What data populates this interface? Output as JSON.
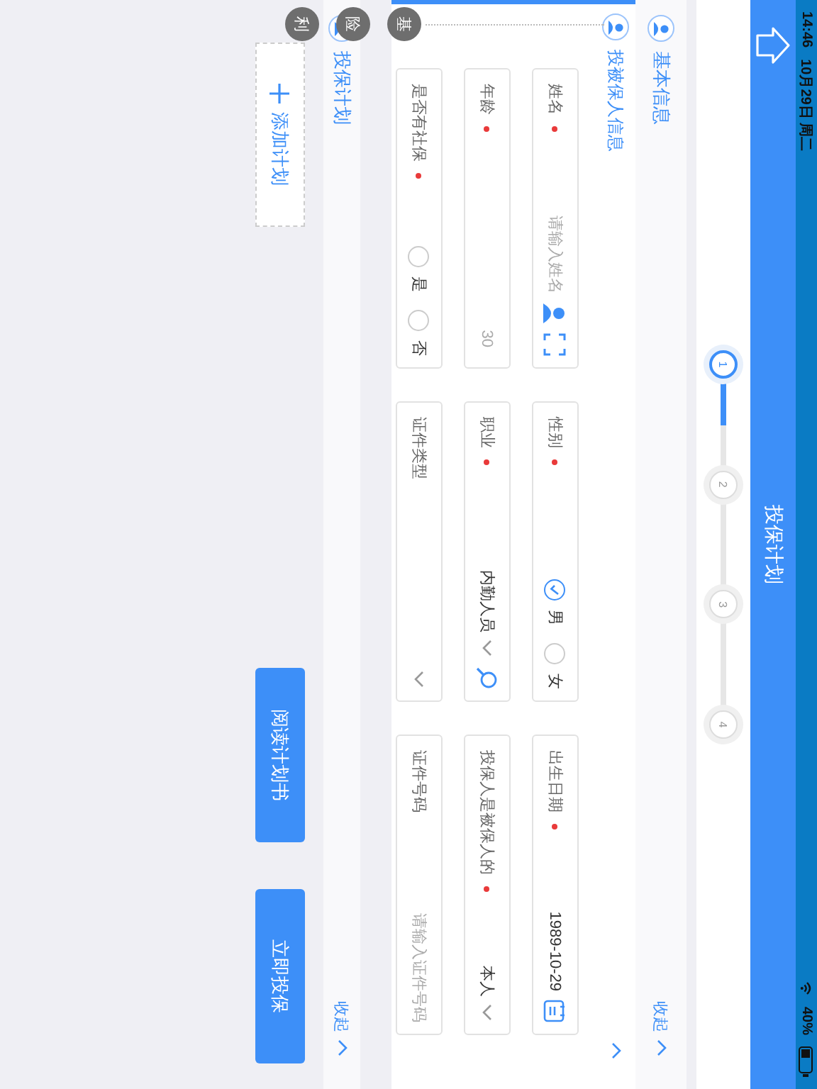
{
  "status_bar": {
    "time": "14:46",
    "date": "10月29日 周二",
    "battery": "40%"
  },
  "header": {
    "title": "投保计划"
  },
  "stepper": {
    "level": 0.17,
    "steps": [
      {
        "label": "1",
        "selected": true
      },
      {
        "label": "2",
        "selected": false
      },
      {
        "label": "3",
        "selected": false
      },
      {
        "label": "4",
        "selected": false
      }
    ]
  },
  "basic_info": {
    "title": "基本信息",
    "toggle": "收起",
    "subsection": {
      "title": "投被保人信息",
      "expanded": true
    },
    "fields": [
      {
        "label": "姓名",
        "required": true,
        "kind": "name",
        "placeholder": "请输入姓名"
      },
      {
        "label": "性别",
        "required": true,
        "kind": "radio",
        "options": [
          {
            "label": "男",
            "selected": true
          },
          {
            "label": "女",
            "selected": false
          }
        ]
      },
      {
        "label": "出生日期",
        "required": true,
        "kind": "date",
        "value": "1989-10-29"
      },
      {
        "label": "年龄",
        "required": true,
        "kind": "auto",
        "value": "30"
      },
      {
        "label": "职业",
        "required": true,
        "kind": "search_select",
        "value": "内勤人员"
      },
      {
        "label": "投保人是被保人的",
        "required": true,
        "kind": "select",
        "value": "本人"
      },
      {
        "label": "是否有社保",
        "required": true,
        "kind": "radio",
        "options": [
          {
            "label": "是",
            "selected": false
          },
          {
            "label": "否",
            "selected": false
          }
        ]
      },
      {
        "label": "证件类型",
        "required": false,
        "kind": "select"
      },
      {
        "label": "证件号码",
        "required": false,
        "kind": "text",
        "placeholder": "请输入证件号码"
      }
    ]
  },
  "side_nav": [
    {
      "label": "基"
    },
    {
      "label": "险"
    },
    {
      "label": "利"
    }
  ],
  "plan": {
    "title": "投保计划",
    "toggle": "收起",
    "add_button": "添加计划"
  },
  "actions": [
    "阅读计划书",
    "立即投保"
  ]
}
